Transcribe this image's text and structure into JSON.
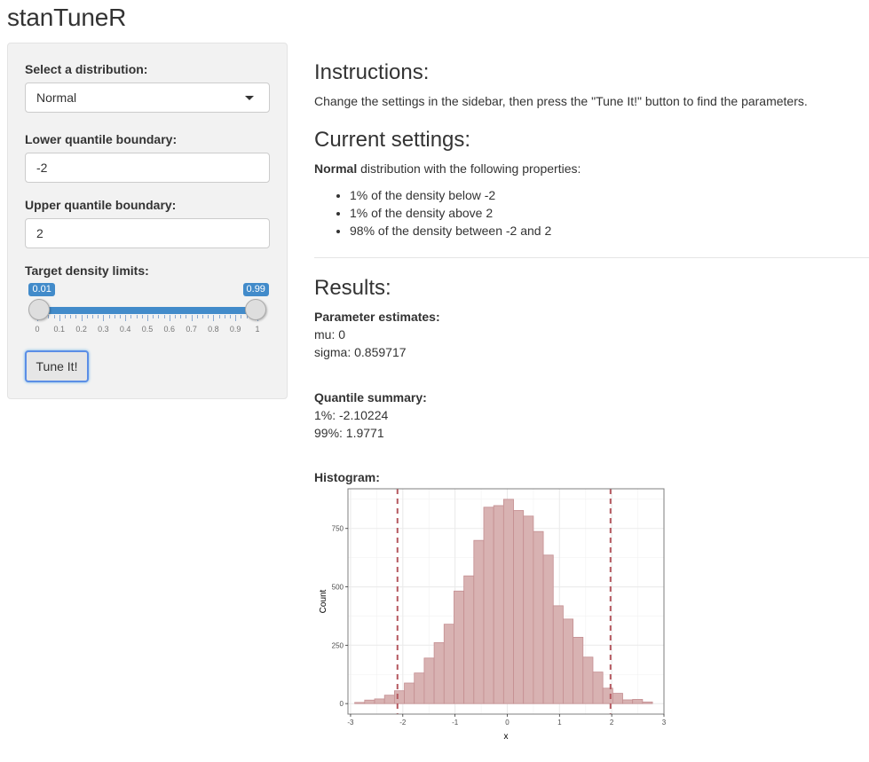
{
  "app": {
    "title": "stanTuneR"
  },
  "sidebar": {
    "distribution": {
      "label": "Select a distribution:",
      "value": "Normal"
    },
    "lower": {
      "label": "Lower quantile boundary:",
      "value": "-2"
    },
    "upper": {
      "label": "Upper quantile boundary:",
      "value": "2"
    },
    "density": {
      "label": "Target density limits:",
      "min": 0,
      "max": 1,
      "low": 0.01,
      "high": 0.99,
      "low_label": "0.01",
      "high_label": "0.99",
      "tick_labels": [
        "0",
        "0.1",
        "0.2",
        "0.3",
        "0.4",
        "0.5",
        "0.6",
        "0.7",
        "0.8",
        "0.9",
        "1"
      ]
    },
    "tune_button": "Tune It!"
  },
  "main": {
    "instructions": {
      "heading": "Instructions:",
      "text": "Change the settings in the sidebar, then press the \"Tune It!\" button to find the parameters."
    },
    "current": {
      "heading": "Current settings:",
      "dist_name": "Normal",
      "intro_rest": " distribution with the following properties:",
      "items": [
        "1% of the density below -2",
        "1% of the density above 2",
        "98% of the density between -2 and 2"
      ]
    },
    "results": {
      "heading": "Results:",
      "param_heading": "Parameter estimates:",
      "params": [
        "mu: 0",
        "sigma: 0.859717"
      ],
      "quant_heading": "Quantile summary:",
      "quantiles": [
        "1%: -2.10224",
        "99%: 1.9771"
      ],
      "hist_heading": "Histogram:"
    }
  },
  "colors": {
    "accent": "#428bca",
    "bar_fill": "#d8b2b2",
    "bar_stroke": "#c48e91",
    "vline": "#b5585f"
  },
  "chart_data": {
    "type": "bar",
    "title": "",
    "xlabel": "x",
    "ylabel": "Count",
    "xlim": [
      -3.05,
      3.0
    ],
    "ylim": [
      -45,
      920
    ],
    "x_ticks": [
      -3,
      -2,
      -1,
      0,
      1,
      2,
      3
    ],
    "x_tick_labels": [
      "-3",
      "-2",
      "-1",
      "0",
      "1",
      "2",
      "3"
    ],
    "y_ticks": [
      0,
      250,
      500,
      750
    ],
    "y_tick_labels": [
      "0",
      "250",
      "500",
      "750"
    ],
    "grid": true,
    "bin_start": -2.92,
    "bin_width": 0.19,
    "values": [
      5,
      15,
      20,
      36,
      55,
      88,
      131,
      195,
      261,
      340,
      482,
      547,
      699,
      841,
      848,
      875,
      827,
      803,
      737,
      636,
      419,
      362,
      284,
      199,
      135,
      66,
      44,
      16,
      18,
      7
    ],
    "vlines": [
      -2.10224,
      1.9771
    ]
  }
}
